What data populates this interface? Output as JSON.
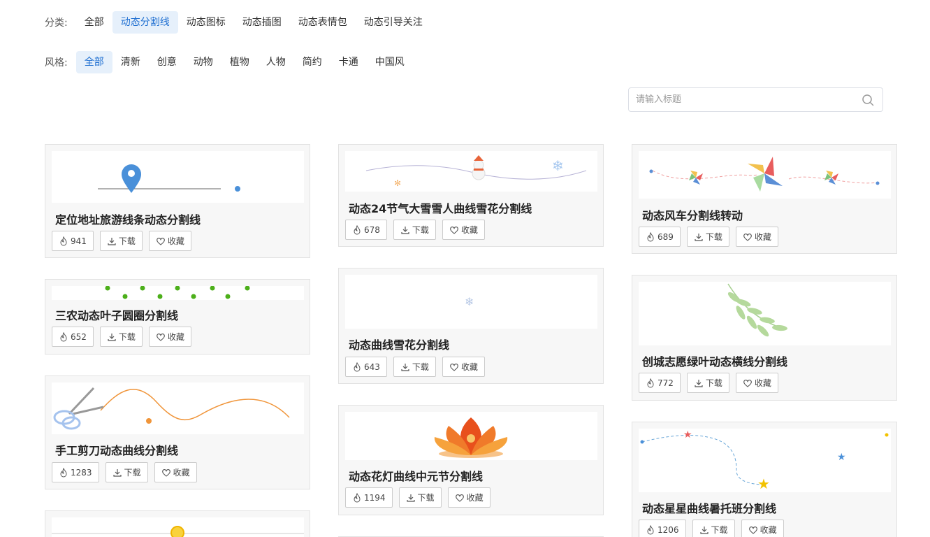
{
  "category": {
    "label": "分类:",
    "items": [
      "全部",
      "动态分割线",
      "动态图标",
      "动态插图",
      "动态表情包",
      "动态引导关注"
    ],
    "active": 1
  },
  "style": {
    "label": "风格:",
    "items": [
      "全部",
      "清新",
      "创意",
      "动物",
      "植物",
      "人物",
      "简约",
      "卡通",
      "中国风"
    ],
    "active": 0
  },
  "search": {
    "placeholder": "请输入标题"
  },
  "actions": {
    "download": "下载",
    "favorite": "收藏"
  },
  "cards": [
    {
      "title": "定位地址旅游线条动态分割线",
      "hot": "941"
    },
    {
      "title": "三农动态叶子圆圈分割线",
      "hot": "652"
    },
    {
      "title": "手工剪刀动态曲线分割线",
      "hot": "1283"
    },
    {
      "title": "动态24节气大雪雪人曲线雪花分割线",
      "hot": "678"
    },
    {
      "title": "动态曲线雪花分割线",
      "hot": "643"
    },
    {
      "title": "动态花灯曲线中元节分割线",
      "hot": "1194"
    },
    {
      "title": "动态风车分割线转动",
      "hot": "689"
    },
    {
      "title": "创城志愿绿叶动态横线分割线",
      "hot": "772"
    },
    {
      "title": "动态星星曲线暑托班分割线",
      "hot": "1206"
    }
  ],
  "colors": {
    "accent": "#1f6fd1",
    "accent_bg": "#e6f0fb"
  }
}
